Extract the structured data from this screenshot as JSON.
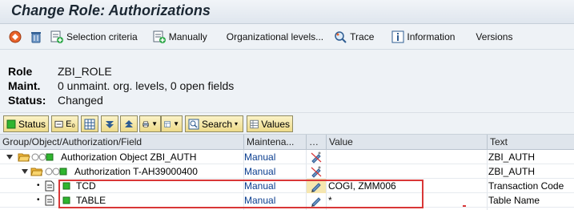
{
  "window": {
    "title": "Change Role: Authorizations"
  },
  "app_toolbar": {
    "items": [
      {
        "icon": "toggle-icon",
        "label": ""
      },
      {
        "icon": "trash-icon",
        "label": ""
      },
      {
        "icon": "add-selection-icon",
        "label": "Selection criteria"
      },
      {
        "icon": "add-manual-icon",
        "label": "Manually"
      },
      {
        "icon": "",
        "label": "Organizational levels..."
      },
      {
        "icon": "trace-icon",
        "label": "Trace"
      },
      {
        "icon": "info-icon",
        "label": "Information"
      },
      {
        "icon": "",
        "label": "Versions"
      }
    ]
  },
  "header": {
    "role_label": "Role",
    "role_value": "ZBI_ROLE",
    "maint_label": "Maint.",
    "maint_value": "0 unmaint. org. levels, 0 open fields",
    "status_label": "Status:",
    "status_value": "Changed"
  },
  "tree_toolbar": {
    "status_label": "Status",
    "search_label": "Search",
    "values_label": "Values"
  },
  "grid": {
    "columns": [
      "Group/Object/Authorization/Field",
      "Maintena...",
      "…",
      "Value",
      "Text"
    ],
    "rows": [
      {
        "label": "Authorization Object ZBI_AUTH",
        "maint": "Manual",
        "value": "",
        "text": "ZBI_AUTH"
      },
      {
        "label": "Authorization T-AH39000400",
        "maint": "Manual",
        "value": "",
        "text": "ZBI_AUTH"
      },
      {
        "label": "TCD",
        "maint": "Manual",
        "value": "COGI, ZMM006",
        "text": "Transaction Code"
      },
      {
        "label": "TABLE",
        "maint": "Manual",
        "value": "*",
        "text": "Table Name"
      }
    ]
  },
  "colors": {
    "folder": "#f3b83a",
    "status_green": "#2fb52f",
    "highlight_red": "#d93737",
    "manual_text": "#0a3d8f"
  }
}
